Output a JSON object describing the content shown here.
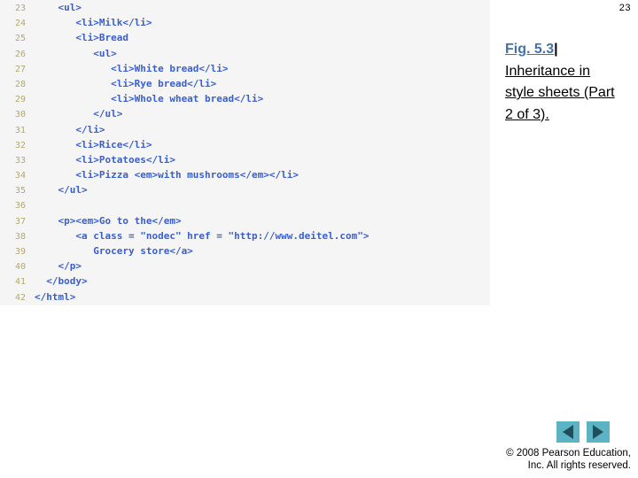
{
  "slide": {
    "page_number": "23"
  },
  "code_listing": {
    "language": "html",
    "background_color": "#f5f5f5",
    "code_color": "#3a5fcd",
    "line_number_color": "#b3a86b",
    "lines": [
      {
        "number": "23",
        "text": "    <ul>"
      },
      {
        "number": "24",
        "text": "       <li>Milk</li>"
      },
      {
        "number": "25",
        "text": "       <li>Bread"
      },
      {
        "number": "26",
        "text": "          <ul>"
      },
      {
        "number": "27",
        "text": "             <li>White bread</li>"
      },
      {
        "number": "28",
        "text": "             <li>Rye bread</li>"
      },
      {
        "number": "29",
        "text": "             <li>Whole wheat bread</li>"
      },
      {
        "number": "30",
        "text": "          </ul>"
      },
      {
        "number": "31",
        "text": "       </li>"
      },
      {
        "number": "32",
        "text": "       <li>Rice</li>"
      },
      {
        "number": "33",
        "text": "       <li>Potatoes</li>"
      },
      {
        "number": "34",
        "text": "       <li>Pizza <em>with mushrooms</em></li>"
      },
      {
        "number": "35",
        "text": "    </ul>"
      },
      {
        "number": "36",
        "text": ""
      },
      {
        "number": "37",
        "text": "    <p><em>Go to the</em>"
      },
      {
        "number": "38",
        "text": "       <a class = \"nodec\" href = \"http://www.deitel.com\">"
      },
      {
        "number": "39",
        "text": "          Grocery store</a>"
      },
      {
        "number": "40",
        "text": "    </p>"
      },
      {
        "number": "41",
        "text": "  </body>"
      },
      {
        "number": "42",
        "text": "</html>"
      }
    ]
  },
  "caption": {
    "label": "Fig. 5.3",
    "separator": "|",
    "text": "Inheritance in style sheets (Part 2 of 3).",
    "label_color": "#4472a8"
  },
  "navigation": {
    "previous_label": "previous-slide",
    "next_label": "next-slide",
    "button_color": "#5cb3c4",
    "arrow_color": "#1f4e5a"
  },
  "footer": {
    "line1": "© 2008 Pearson Education,",
    "line2": "Inc.  All rights reserved."
  }
}
